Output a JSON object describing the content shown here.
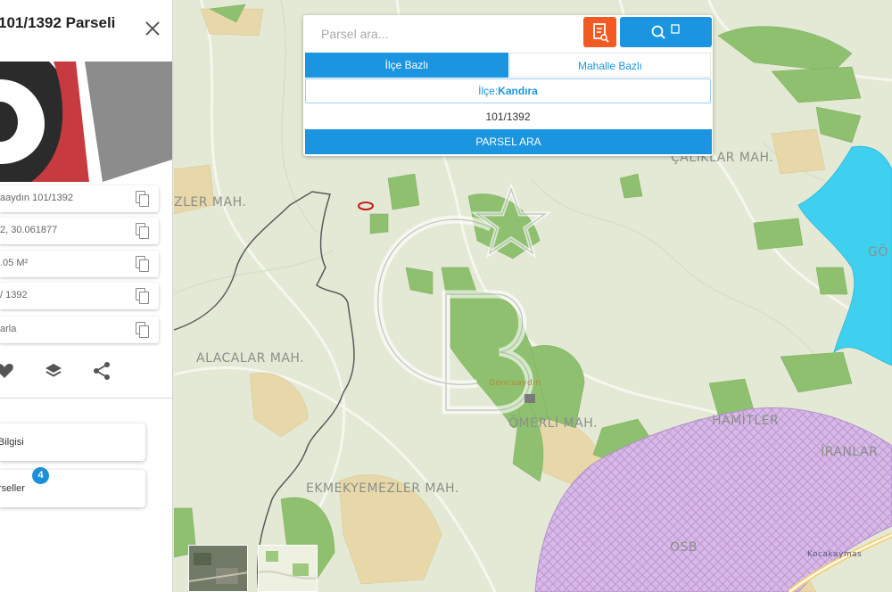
{
  "panel": {
    "title": "101/1392 Parseli",
    "rows": [
      {
        "text": "aaydın 101/1392"
      },
      {
        "text": "2, 30.061877"
      },
      {
        "text": ".05 M²"
      },
      {
        "text": "/ 1392"
      },
      {
        "text": "arla"
      }
    ],
    "cards": [
      {
        "text": "Bilgisi"
      },
      {
        "text": "rseller"
      }
    ],
    "badge": "4",
    "icons": [
      "heart-icon",
      "layers-icon",
      "share-icon"
    ]
  },
  "search": {
    "placeholder": "Parsel ara...",
    "tabs": [
      {
        "label": "İlçe Bazlı",
        "active": true
      },
      {
        "label": "Mahalle Bazlı",
        "active": false
      }
    ],
    "district_prefix": "İlçe:",
    "district_value": "Kandıra",
    "parcel_number": "101/1392",
    "search_button": "PARSEL ARA"
  },
  "map": {
    "labels": [
      {
        "text": "ALACALAR MAH."
      },
      {
        "text": "EKMEKYEMEZLER MAH."
      },
      {
        "text": "ÖMERLİ MAH."
      },
      {
        "text": "HAMİTLER"
      },
      {
        "text": "İRANLAR"
      },
      {
        "text": "ÇALIKLAR MAH."
      },
      {
        "text": "ZLER MAH."
      },
      {
        "text": "GÖ"
      },
      {
        "text": "OSB"
      },
      {
        "text": "Goncaaydın"
      },
      {
        "text": "Kocakaymas"
      }
    ],
    "watermark": "CB",
    "colors": {
      "base": "#e3e9d4",
      "forest": "#8cbf6e",
      "field": "#e6d6a8",
      "lake": "#3fd0f0",
      "industrial": "#d8b8e8",
      "accent": "#1b95e0",
      "orange": "#f15a22"
    }
  }
}
